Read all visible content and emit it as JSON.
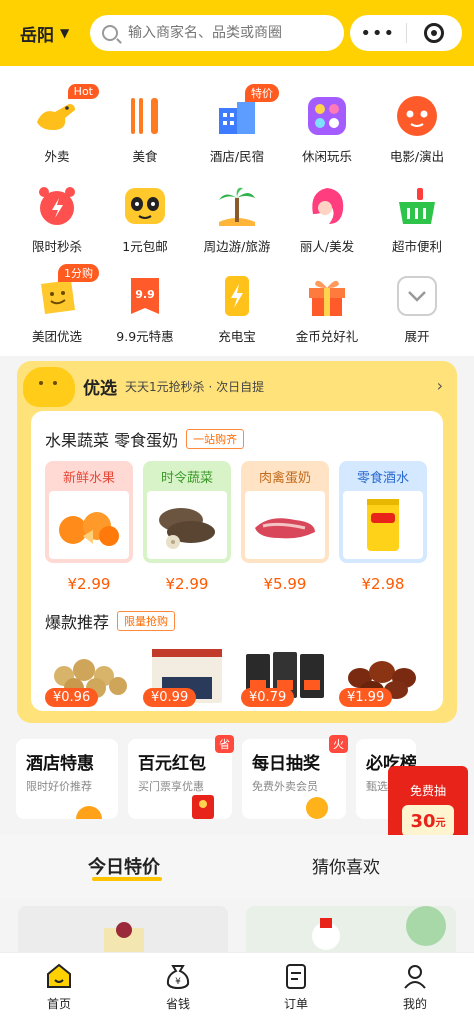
{
  "header": {
    "city": "岳阳",
    "search_placeholder": "输入商家名、品类或商圈",
    "more_label": "•••"
  },
  "categories": [
    {
      "label": "外卖",
      "icon": "duck-takeout-icon",
      "badge": "Hot"
    },
    {
      "label": "美食",
      "icon": "fork-knife-icon",
      "badge": ""
    },
    {
      "label": "酒店/民宿",
      "icon": "hotel-building-icon",
      "badge": "特价"
    },
    {
      "label": "休闲玩乐",
      "icon": "leisure-icon",
      "badge": ""
    },
    {
      "label": "电影/演出",
      "icon": "cat-movie-icon",
      "badge": ""
    },
    {
      "label": "限时秒杀",
      "icon": "alarm-clock-icon",
      "badge": ""
    },
    {
      "label": "1元包邮",
      "icon": "panda-icon",
      "badge": ""
    },
    {
      "label": "周边游/旅游",
      "icon": "palm-tree-icon",
      "badge": ""
    },
    {
      "label": "丽人/美发",
      "icon": "beauty-hair-icon",
      "badge": ""
    },
    {
      "label": "超市便利",
      "icon": "shopping-basket-icon",
      "badge": ""
    },
    {
      "label": "美团优选",
      "icon": "youxuan-bag-icon",
      "badge": "1分购"
    },
    {
      "label": "9.9元特惠",
      "icon": "price-tag-icon",
      "badge": ""
    },
    {
      "label": "充电宝",
      "icon": "power-bank-icon",
      "badge": ""
    },
    {
      "label": "金币兑好礼",
      "icon": "gift-box-icon",
      "badge": ""
    },
    {
      "label": "展开",
      "icon": "expand-chevron-icon",
      "badge": ""
    }
  ],
  "youxuan": {
    "title": "优选",
    "subtitle": "天天1元抢秒杀 · 次日自提",
    "section1_title": "水果蔬菜 零食蛋奶",
    "section1_tag": "一站购齐",
    "products": [
      {
        "category": "新鲜水果",
        "price": "¥2.99"
      },
      {
        "category": "时令蔬菜",
        "price": "¥2.99"
      },
      {
        "category": "肉禽蛋奶",
        "price": "¥5.99"
      },
      {
        "category": "零食酒水",
        "price": "¥2.98"
      }
    ],
    "section2_title": "爆款推荐",
    "section2_tag": "限量抢购",
    "hot_items": [
      {
        "price": "¥0.96"
      },
      {
        "price": "¥0.99"
      },
      {
        "price": "¥0.79"
      },
      {
        "price": "¥1.99"
      }
    ]
  },
  "promos": [
    {
      "title": "酒店特惠",
      "subtitle": "限时好价推荐",
      "corner": ""
    },
    {
      "title": "百元红包",
      "subtitle": "买门票享优惠",
      "corner": "省"
    },
    {
      "title": "每日抽奖",
      "subtitle": "免费外卖会员",
      "corner": "火"
    },
    {
      "title": "必吃榜",
      "subtitle": "甄选",
      "corner": ""
    }
  ],
  "lottery": {
    "label": "免费抽",
    "value": "30",
    "unit": "元"
  },
  "tabs": [
    "今日特价",
    "猜你喜欢"
  ],
  "nav": [
    {
      "label": "首页",
      "icon": "home-icon"
    },
    {
      "label": "省钱",
      "icon": "money-bag-icon"
    },
    {
      "label": "订单",
      "icon": "order-list-icon"
    },
    {
      "label": "我的",
      "icon": "profile-icon"
    }
  ],
  "colors": {
    "brand_yellow": "#ffd100",
    "accent_orange": "#ff5a1f",
    "price_orange": "#ff5a00"
  }
}
